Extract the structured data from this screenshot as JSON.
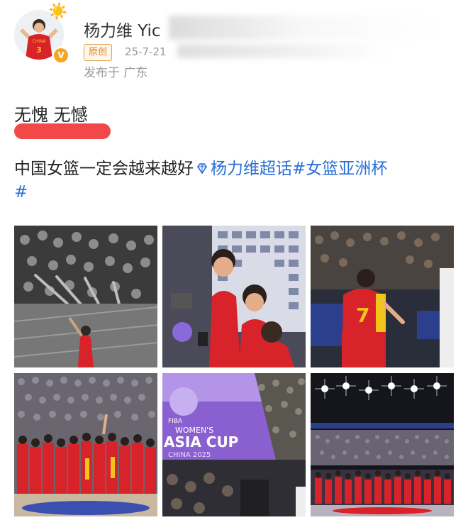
{
  "author": {
    "name": "杨力维 Yic",
    "badge": "原创",
    "timestamp": "25-7-21",
    "location": "发布于 广东",
    "avatar_jersey_text": "CHINA",
    "avatar_jersey_number": "3",
    "verified_mark": "V"
  },
  "post": {
    "line1": "无愧 无憾",
    "line2_text": "中国女篮一定会越来越好",
    "tag_super_topic": "杨力维超话",
    "tag_hashtag": "#女篮亚洲杯",
    "line3": "#"
  },
  "photos": [
    {
      "name": "photo-1-bw-fans"
    },
    {
      "name": "photo-2-interview"
    },
    {
      "name": "photo-3-player-7",
      "jersey_number": "7"
    },
    {
      "name": "photo-4-team-huddle"
    },
    {
      "name": "photo-5-asia-cup-banner",
      "banner_text_1": "FIBA",
      "banner_text_2": "WOMEN'S",
      "banner_text_3": "ASIA CUP",
      "banner_text_4": "CHINA 2025"
    },
    {
      "name": "photo-6-arena-lights"
    }
  ],
  "colors": {
    "accent_link": "#2a6fd6",
    "badge_orange": "#d9822b",
    "jersey_red": "#d8232a",
    "jersey_yellow": "#f3c419"
  }
}
